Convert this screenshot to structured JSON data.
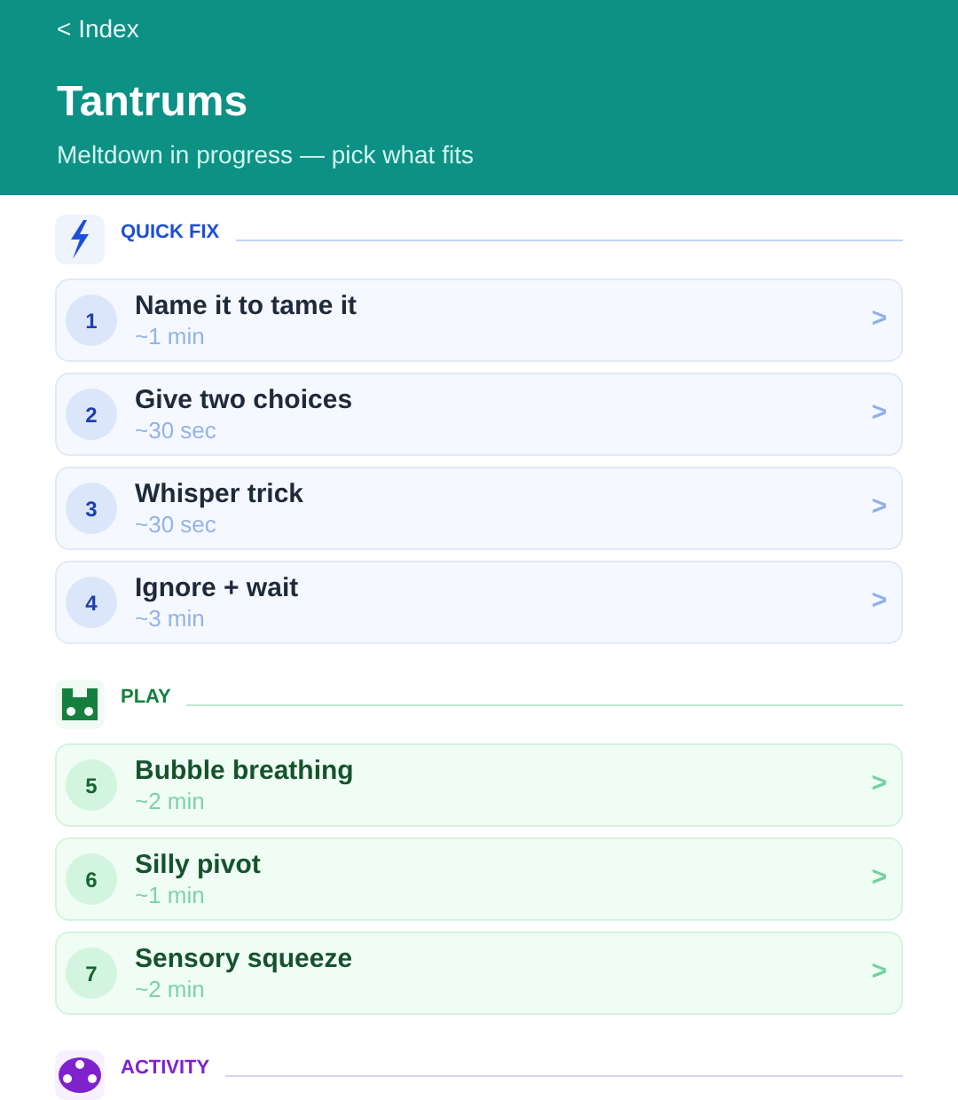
{
  "header": {
    "back_link": "< Index",
    "title": "Tantrums",
    "subtitle": "Meltdown in progress — pick what fits"
  },
  "sections": [
    {
      "kind": "quick",
      "title": "QUICK FIX",
      "items": [
        {
          "number": "1",
          "title": "Name it to tame it",
          "duration": "~1 min",
          "chevron": ">"
        },
        {
          "number": "2",
          "title": "Give two choices",
          "duration": "~30 sec",
          "chevron": ">"
        },
        {
          "number": "3",
          "title": "Whisper trick",
          "duration": "~30 sec",
          "chevron": ">"
        },
        {
          "number": "4",
          "title": "Ignore + wait",
          "duration": "~3 min",
          "chevron": ">"
        }
      ]
    },
    {
      "kind": "play",
      "title": "PLAY",
      "items": [
        {
          "number": "5",
          "title": "Bubble breathing",
          "duration": "~2 min",
          "chevron": ">"
        },
        {
          "number": "6",
          "title": "Silly pivot",
          "duration": "~1 min",
          "chevron": ">"
        },
        {
          "number": "7",
          "title": "Sensory squeeze",
          "duration": "~2 min",
          "chevron": ">"
        }
      ]
    },
    {
      "kind": "activity",
      "title": "ACTIVITY"
    }
  ]
}
